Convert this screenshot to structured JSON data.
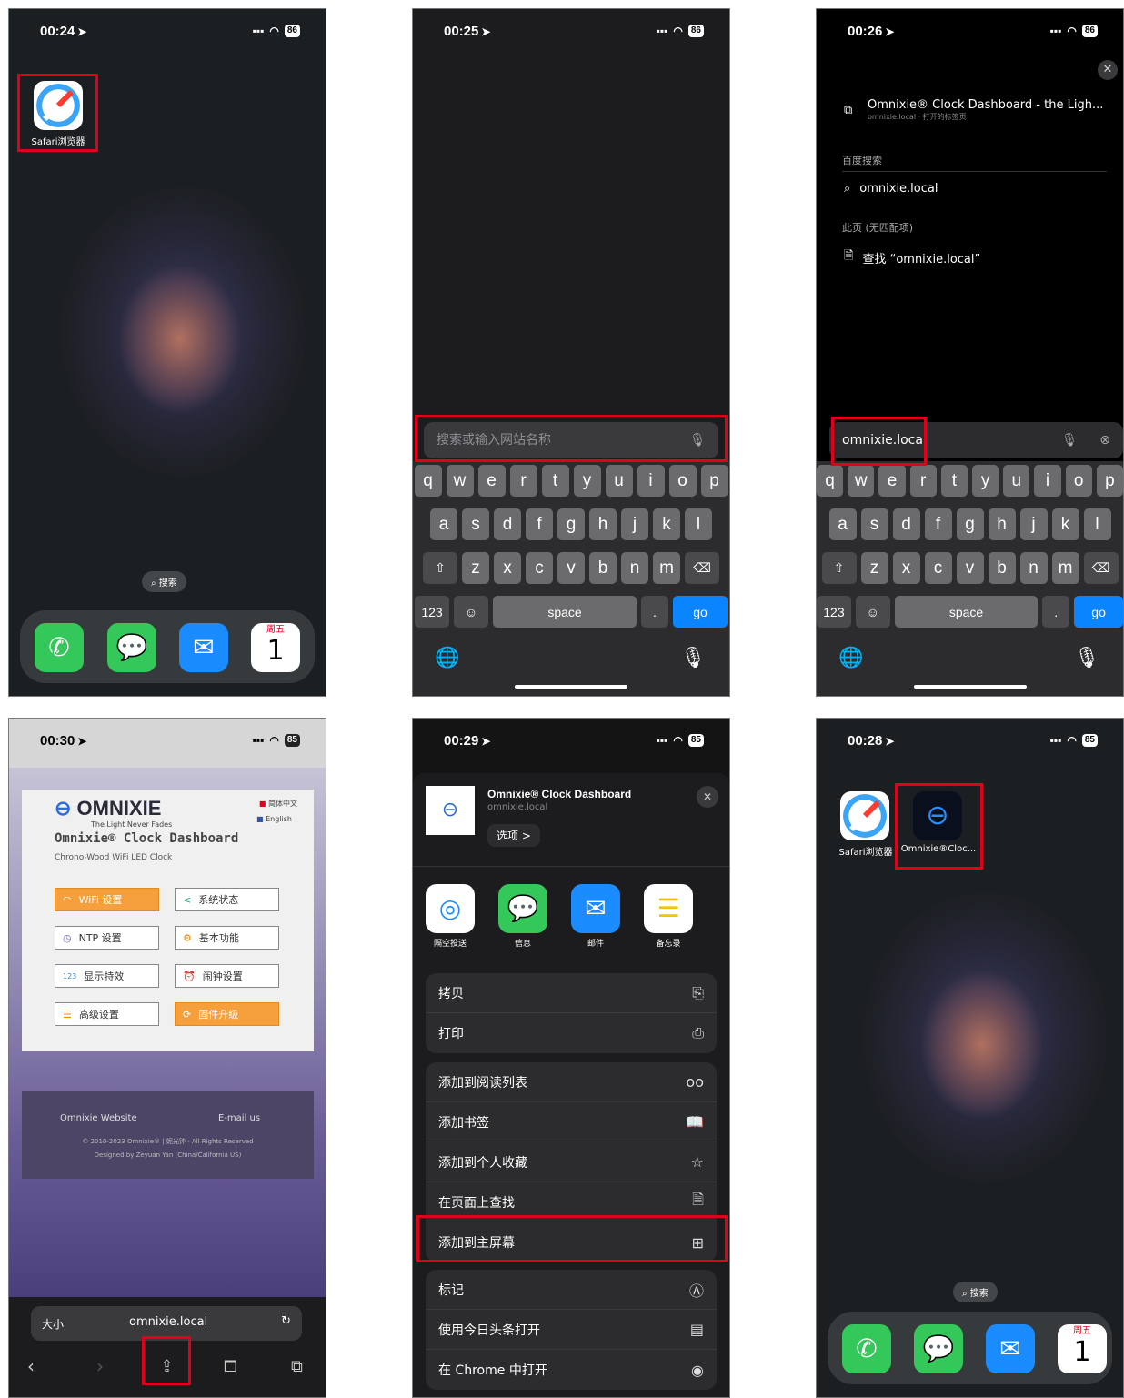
{
  "p1": {
    "time": "00:24",
    "battery": "86",
    "safari_label": "Safari浏览器",
    "search": "搜索",
    "cal_day": "周五",
    "cal_num": "1"
  },
  "p2": {
    "time": "00:25",
    "battery": "86",
    "placeholder": "搜索或输入网站名称",
    "row1": [
      "q",
      "w",
      "e",
      "r",
      "t",
      "y",
      "u",
      "i",
      "o",
      "p"
    ],
    "row2": [
      "a",
      "s",
      "d",
      "f",
      "g",
      "h",
      "j",
      "k",
      "l"
    ],
    "row3": [
      "z",
      "x",
      "c",
      "v",
      "b",
      "n",
      "m"
    ],
    "k123": "123",
    "space": "space",
    "dot": ".",
    "go": "go"
  },
  "p3": {
    "time": "00:26",
    "battery": "86",
    "suggest_title": "Omnixie® Clock Dashboard - the Ligh...",
    "suggest_sub": "omnixie.local · 打开的标签页",
    "section1": "百度搜索",
    "query": "omnixie.local",
    "section2": "此页 (无匹配项)",
    "find": "查找 “omnixie.local”",
    "input": "omnixie.local"
  },
  "p4": {
    "time": "00:30",
    "battery": "85",
    "brand": "OMNIXIE",
    "tagline": "The Light Never Fades",
    "lang1": "简体中文",
    "lang2": "English",
    "title": "Omnixie® Clock Dashboard",
    "subtitle": "Chrono-Wood WiFi LED Clock",
    "buttons": [
      "WiFi 设置",
      "系统状态",
      "NTP 设置",
      "基本功能",
      "显示特效",
      "闹钟设置",
      "高级设置",
      "固件升级"
    ],
    "footer_link1": "Omnixie Website",
    "footer_link2": "E-mail us",
    "copyright": "© 2010-2023 Omnixie® | 妮光钟 - All Rights Reserved",
    "designed": "Designed by Zeyuan Yan (China/California US)",
    "size": "大小",
    "url": "omnixie.local"
  },
  "p5": {
    "time": "00:29",
    "battery": "85",
    "share_title": "Omnixie® Clock Dashboard",
    "share_url": "omnixie.local",
    "options": "选项 >",
    "apps": [
      "隔空投送",
      "信息",
      "邮件",
      "备忘录"
    ],
    "group1": [
      "拷贝",
      "打印"
    ],
    "group2": [
      "添加到阅读列表",
      "添加书签",
      "添加到个人收藏",
      "在页面上查找",
      "添加到主屏幕"
    ],
    "group3": [
      "标记",
      "使用今日头条打开",
      "在 Chrome 中打开"
    ]
  },
  "p6": {
    "time": "00:28",
    "battery": "85",
    "safari_label": "Safari浏览器",
    "omnixie_label": "Omnixie®Cloc...",
    "search": "搜索",
    "cal_day": "周五",
    "cal_num": "1"
  }
}
